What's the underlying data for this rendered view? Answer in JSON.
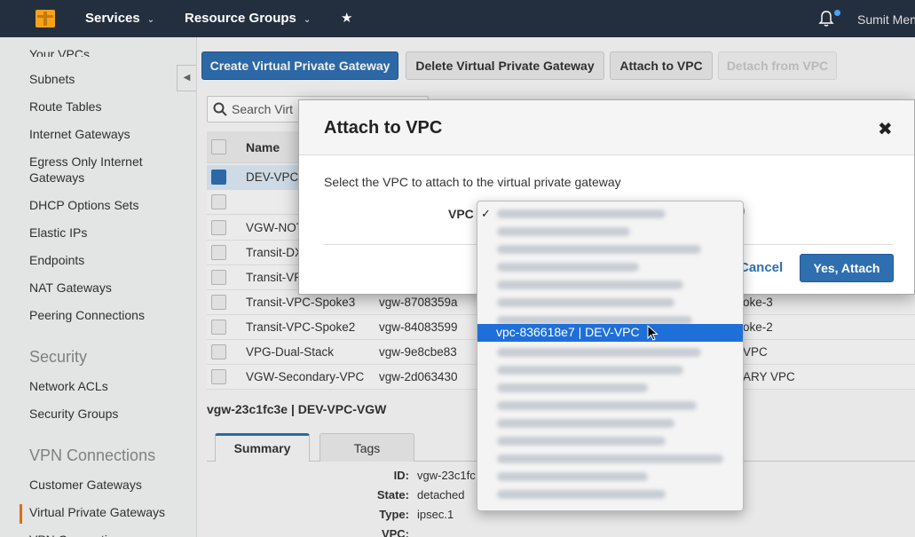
{
  "topnav": {
    "services": "Services",
    "resource_groups": "Resource Groups",
    "user": "Sumit Men"
  },
  "sidebar": {
    "items": [
      {
        "label": "Your VPCs"
      },
      {
        "label": "Subnets"
      },
      {
        "label": "Route Tables"
      },
      {
        "label": "Internet Gateways"
      },
      {
        "label": "Egress Only Internet Gateways"
      },
      {
        "label": "DHCP Options Sets"
      },
      {
        "label": "Elastic IPs"
      },
      {
        "label": "Endpoints"
      },
      {
        "label": "NAT Gateways"
      },
      {
        "label": "Peering Connections"
      }
    ],
    "security_header": "Security",
    "security_items": [
      {
        "label": "Network ACLs"
      },
      {
        "label": "Security Groups"
      }
    ],
    "vpn_header": "VPN Connections",
    "vpn_items": [
      {
        "label": "Customer Gateways"
      },
      {
        "label": "Virtual Private Gateways"
      },
      {
        "label": "VPN Connections"
      }
    ]
  },
  "toolbar": {
    "create": "Create Virtual Private Gateway",
    "delete": "Delete Virtual Private Gateway",
    "attach": "Attach to VPC",
    "detach": "Detach from VPC"
  },
  "search": {
    "placeholder": "Search Virt"
  },
  "table": {
    "name_header": "Name",
    "rows": [
      {
        "name": "DEV-VPC",
        "id": "",
        "extra": ""
      },
      {
        "name": "",
        "id": "",
        "extra": ""
      },
      {
        "name": "VGW-NOT",
        "id": "",
        "extra": ""
      },
      {
        "name": "Transit-DX",
        "id": "",
        "extra": ""
      },
      {
        "name": "Transit-VP",
        "id": "",
        "extra": ""
      },
      {
        "name": "Transit-VPC-Spoke3",
        "id": "vgw-8708359a",
        "extra": "oke-3"
      },
      {
        "name": "Transit-VPC-Spoke2",
        "id": "vgw-84083599",
        "extra": "oke-2"
      },
      {
        "name": "VPG-Dual-Stack",
        "id": "vgw-9e8cbe83",
        "extra": "VPC"
      },
      {
        "name": "VGW-Secondary-VPC",
        "id": "vgw-2d063430",
        "extra": "ARY VPC"
      }
    ]
  },
  "detail": {
    "title": "vgw-23c1fc3e | DEV-VPC-VGW",
    "tabs": [
      "Summary",
      "Tags"
    ],
    "fields": [
      {
        "key": "ID:",
        "value": "vgw-23c1fc"
      },
      {
        "key": "State:",
        "value": "detached"
      },
      {
        "key": "Type:",
        "value": "ipsec.1"
      },
      {
        "key": "VPC:",
        "value": ""
      }
    ]
  },
  "modal": {
    "title": "Attach to VPC",
    "close": "✖",
    "description": "Select the VPC to attach to the virtual private gateway",
    "vpc_label": "VPC",
    "cancel": "Cancel",
    "confirm": "Yes, Attach"
  },
  "dropdown": {
    "highlighted": "vpc-836618e7 | DEV-VPC"
  }
}
